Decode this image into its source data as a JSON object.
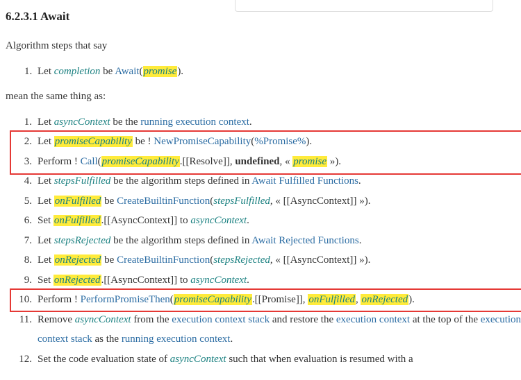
{
  "heading": "6.2.3.1  Await",
  "intro": "Algorithm steps that say",
  "simpleStep": {
    "prefix": "Let ",
    "var1": "completion",
    "mid": " be ",
    "await": "Await",
    "open": "(",
    "arg": "promise",
    "close": ")."
  },
  "mean": "mean the same thing as:",
  "steps": {
    "s1": {
      "a": "Let ",
      "b": "asyncContext",
      "c": " be the ",
      "d": "running execution context",
      "e": "."
    },
    "s2": {
      "a": "Let ",
      "b": "promiseCapability",
      "c": " be ! ",
      "d": "NewPromiseCapability",
      "e": "(",
      "f": "%Promise%",
      "g": ")."
    },
    "s3": {
      "a": "Perform ! ",
      "b": "Call",
      "c": "(",
      "d": "promiseCapability",
      "e": ".[[Resolve]], ",
      "f": "undefined",
      "g": ", « ",
      "h": "promise",
      "i": " »)."
    },
    "s4": {
      "a": "Let ",
      "b": "stepsFulfilled",
      "c": " be the algorithm steps defined in ",
      "d": "Await Fulfilled Functions",
      "e": "."
    },
    "s5": {
      "a": "Let ",
      "b": "onFulfilled",
      "c": " be ",
      "d": "CreateBuiltinFunction",
      "e": "(",
      "f": "stepsFulfilled",
      "g": ", « [[AsyncContext]] »)."
    },
    "s6": {
      "a": "Set ",
      "b": "onFulfilled",
      "c": ".[[AsyncContext]] to ",
      "d": "asyncContext",
      "e": "."
    },
    "s7": {
      "a": "Let ",
      "b": "stepsRejected",
      "c": " be the algorithm steps defined in ",
      "d": "Await Rejected Functions",
      "e": "."
    },
    "s8": {
      "a": "Let ",
      "b": "onRejected",
      "c": " be ",
      "d": "CreateBuiltinFunction",
      "e": "(",
      "f": "stepsRejected",
      "g": ", « [[AsyncContext]] »)."
    },
    "s9": {
      "a": "Set ",
      "b": "onRejected",
      "c": ".[[AsyncContext]] to ",
      "d": "asyncContext",
      "e": "."
    },
    "s10": {
      "a": "Perform ! ",
      "b": "PerformPromiseThen",
      "c": "(",
      "d": "promiseCapability",
      "e": ".[[Promise]], ",
      "f": "onFulfilled",
      "g": ", ",
      "h": "onRejected",
      "i": ")."
    },
    "s11": {
      "a": "Remove ",
      "b": "asyncContext",
      "c": " from the ",
      "d": "execution context stack",
      "e": " and restore the ",
      "f": "execution context",
      "g": " at the top of the ",
      "h": "execution context stack",
      "i": " as the ",
      "j": "running execution context",
      "k": "."
    },
    "s12": {
      "a": "Set the code evaluation state of ",
      "b": "asyncContext",
      "c": " such that when evaluation is resumed with a"
    }
  }
}
